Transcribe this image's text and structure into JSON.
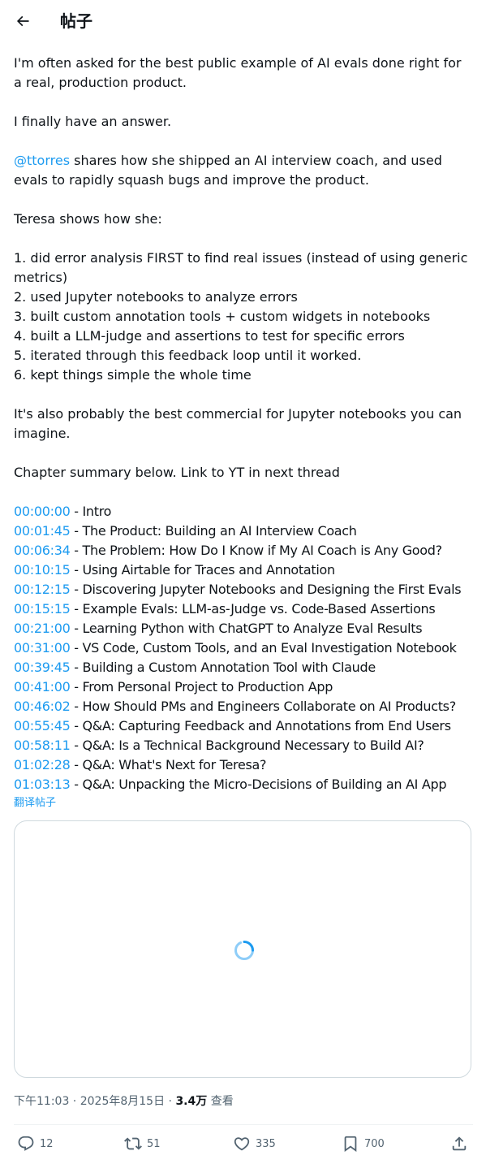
{
  "header": {
    "title": "帖子"
  },
  "post": {
    "paragraphs": [
      "I'm often asked for the best public example of AI evals done right for a real, production product.",
      "I finally have an answer."
    ],
    "mention": "@ttorres",
    "mention_rest": " shares how she shipped an AI interview coach, and used evals to rapidly squash bugs and improve the product.",
    "intro": "Teresa shows how she:",
    "steps": [
      "1. did error analysis FIRST to find real issues (instead of using generic metrics)",
      "2. used Jupyter notebooks to analyze errors",
      "3. built custom annotation tools + custom widgets in notebooks",
      "4. built a LLM-judge and assertions to test for specific errors",
      "5. iterated through this feedback loop until it worked.",
      "6. kept things simple the whole time"
    ],
    "commercial": "It's also probably the best commercial for Jupyter notebooks you can imagine.",
    "summary": "Chapter summary below. Link to YT in next thread",
    "chapters": [
      {
        "time": "00:00:00",
        "title": " - Intro"
      },
      {
        "time": "00:01:45",
        "title": " - The Product: Building an AI Interview Coach"
      },
      {
        "time": "00:06:34",
        "title": " - The Problem: How Do I Know if My AI Coach is Any Good?"
      },
      {
        "time": "00:10:15",
        "title": " - Using Airtable for Traces and Annotation"
      },
      {
        "time": "00:12:15",
        "title": " - Discovering Jupyter Notebooks and Designing the First Evals"
      },
      {
        "time": "00:15:15",
        "title": " - Example Evals: LLM-as-Judge vs. Code-Based Assertions"
      },
      {
        "time": "00:21:00",
        "title": " - Learning Python with ChatGPT to Analyze Eval Results"
      },
      {
        "time": "00:31:00",
        "title": " - VS Code, Custom Tools, and an Eval Investigation Notebook"
      },
      {
        "time": "00:39:45",
        "title": " - Building a Custom Annotation Tool with Claude"
      },
      {
        "time": "00:41:00",
        "title": " - From Personal Project to Production App"
      },
      {
        "time": "00:46:02",
        "title": " - How Should PMs and Engineers Collaborate on AI Products?"
      },
      {
        "time": "00:55:45",
        "title": " - Q&A: Capturing Feedback and Annotations from End Users"
      },
      {
        "time": "00:58:11",
        "title": " - Q&A: Is a Technical Background Necessary to Build AI?"
      },
      {
        "time": "01:02:28",
        "title": " - Q&A: What's Next for Teresa?"
      },
      {
        "time": "01:03:13",
        "title": " - Q&A: Unpacking the Micro-Decisions of Building an AI App"
      }
    ],
    "translate_label": "翻译帖子"
  },
  "meta": {
    "time": "下午11:03",
    "sep1": " · ",
    "date": "2025年8月15日",
    "sep2": " · ",
    "views_count": "3.4万",
    "views_label": " 查看"
  },
  "actions": {
    "replies": "12",
    "reposts": "51",
    "likes": "335",
    "bookmarks": "700"
  },
  "icons": [
    "back-arrow-icon",
    "loading-spinner-icon",
    "reply-icon",
    "repost-icon",
    "like-icon",
    "bookmark-icon",
    "share-icon"
  ],
  "colors": {
    "accent": "#1d9bf0",
    "text": "#0f1419",
    "muted": "#536471",
    "border": "#cfd9de"
  }
}
